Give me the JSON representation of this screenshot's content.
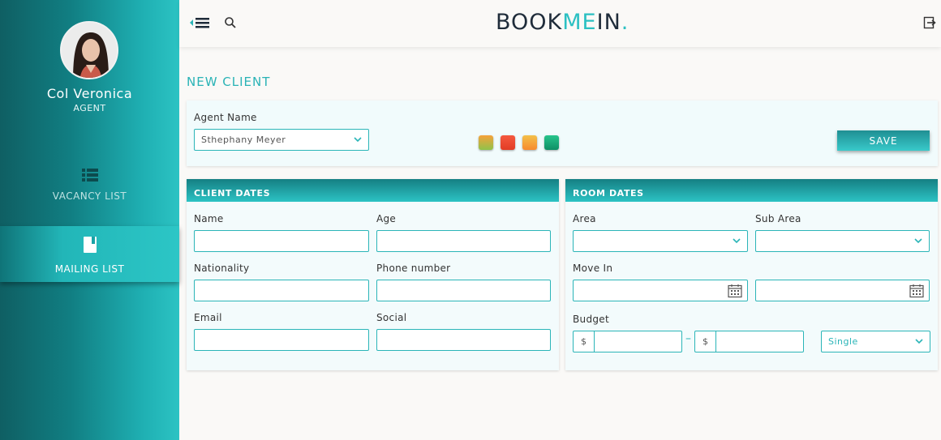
{
  "user": {
    "name": "Col Veronica",
    "role": "AGENT"
  },
  "nav": [
    {
      "label": "VACANCY LIST",
      "icon": "list-icon"
    },
    {
      "label": "MAILING LIST",
      "icon": "book-icon"
    }
  ],
  "brand": {
    "part1": "BOOK",
    "part2": "ME",
    "part3": "IN",
    "dot": "."
  },
  "page_title": "NEW CLIENT",
  "agent": {
    "label": "Agent Name",
    "selected": "Sthephany Meyer"
  },
  "swatches": [
    "#8fc34a",
    "#f04a2f",
    "#f8a33a",
    "#1aa978"
  ],
  "save_label": "SAVE",
  "client_card": {
    "title": "CLIENT DATES",
    "fields": {
      "name": "Name",
      "age": "Age",
      "nationality": "Nationality",
      "phone": "Phone number",
      "email": "Email",
      "social": "Social"
    }
  },
  "room_card": {
    "title": "ROOM DATES",
    "area": "Area",
    "sub_area": "Sub Area",
    "move_in": "Move In",
    "budget": "Budget",
    "currency": "$",
    "range_dash": "–",
    "room_type": "Single"
  }
}
